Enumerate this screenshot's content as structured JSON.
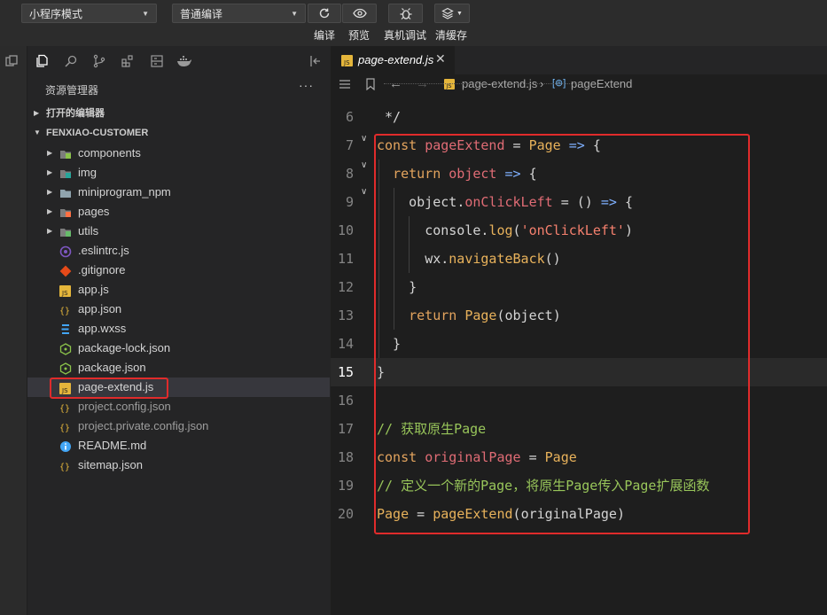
{
  "toolbar": {
    "mode_select": "小程序模式",
    "compile_select": "普通编译",
    "buttons": [
      {
        "label": "编译",
        "icon": "refresh-icon"
      },
      {
        "label": "预览",
        "icon": "eye-icon"
      },
      {
        "label": "真机调试",
        "icon": "bug-icon"
      },
      {
        "label": "清缓存",
        "icon": "layers-icon"
      }
    ]
  },
  "explorer": {
    "title": "资源管理器",
    "more": "···",
    "open_editors": "打开的编辑器",
    "project": "FENXIAO-CUSTOMER",
    "files": [
      {
        "name": "components",
        "type": "folder",
        "icon": "components-folder-icon"
      },
      {
        "name": "img",
        "type": "folder",
        "icon": "image-folder-icon"
      },
      {
        "name": "miniprogram_npm",
        "type": "folder",
        "icon": "folder-icon"
      },
      {
        "name": "pages",
        "type": "folder",
        "icon": "pages-folder-icon"
      },
      {
        "name": "utils",
        "type": "folder",
        "icon": "utils-folder-icon"
      },
      {
        "name": ".eslintrc.js",
        "type": "file",
        "icon": "eslint-icon"
      },
      {
        "name": ".gitignore",
        "type": "file",
        "icon": "git-icon"
      },
      {
        "name": "app.js",
        "type": "file",
        "icon": "js-icon"
      },
      {
        "name": "app.json",
        "type": "file",
        "icon": "json-icon"
      },
      {
        "name": "app.wxss",
        "type": "file",
        "icon": "css-icon"
      },
      {
        "name": "package-lock.json",
        "type": "file",
        "icon": "node-icon"
      },
      {
        "name": "package.json",
        "type": "file",
        "icon": "node-icon"
      },
      {
        "name": "page-extend.js",
        "type": "file",
        "icon": "js-icon",
        "selected": true
      },
      {
        "name": "project.config.json",
        "type": "file",
        "icon": "json-icon",
        "dim": true
      },
      {
        "name": "project.private.config.json",
        "type": "file",
        "icon": "json-icon",
        "dim": true
      },
      {
        "name": "README.md",
        "type": "file",
        "icon": "info-icon"
      },
      {
        "name": "sitemap.json",
        "type": "file",
        "icon": "json-icon"
      }
    ]
  },
  "editor": {
    "tab": "page-extend.js",
    "breadcrumb_file": "page-extend.js",
    "breadcrumb_symbol": "pageExtend",
    "current_line": "15",
    "lines": [
      {
        "n": "6",
        "text": " */"
      },
      {
        "n": "7",
        "text": "const pageExtend = Page => {"
      },
      {
        "n": "8",
        "text": "  return object => {"
      },
      {
        "n": "9",
        "text": "    object.onClickLeft = () => {"
      },
      {
        "n": "10",
        "text": "      console.log('onClickLeft')"
      },
      {
        "n": "11",
        "text": "      wx.navigateBack()"
      },
      {
        "n": "12",
        "text": "    }"
      },
      {
        "n": "13",
        "text": "    return Page(object)"
      },
      {
        "n": "14",
        "text": "  }"
      },
      {
        "n": "15",
        "text": "}"
      },
      {
        "n": "16",
        "text": ""
      },
      {
        "n": "17",
        "text": "// 获取原生Page"
      },
      {
        "n": "18",
        "text": "const originalPage = Page"
      },
      {
        "n": "19",
        "text": "// 定义一个新的Page，将原生Page传入Page扩展函数"
      },
      {
        "n": "20",
        "text": "Page = pageExtend(originalPage)"
      }
    ]
  },
  "colors": {
    "highlight": "#e02b2b",
    "selected_row": "#37373d"
  }
}
